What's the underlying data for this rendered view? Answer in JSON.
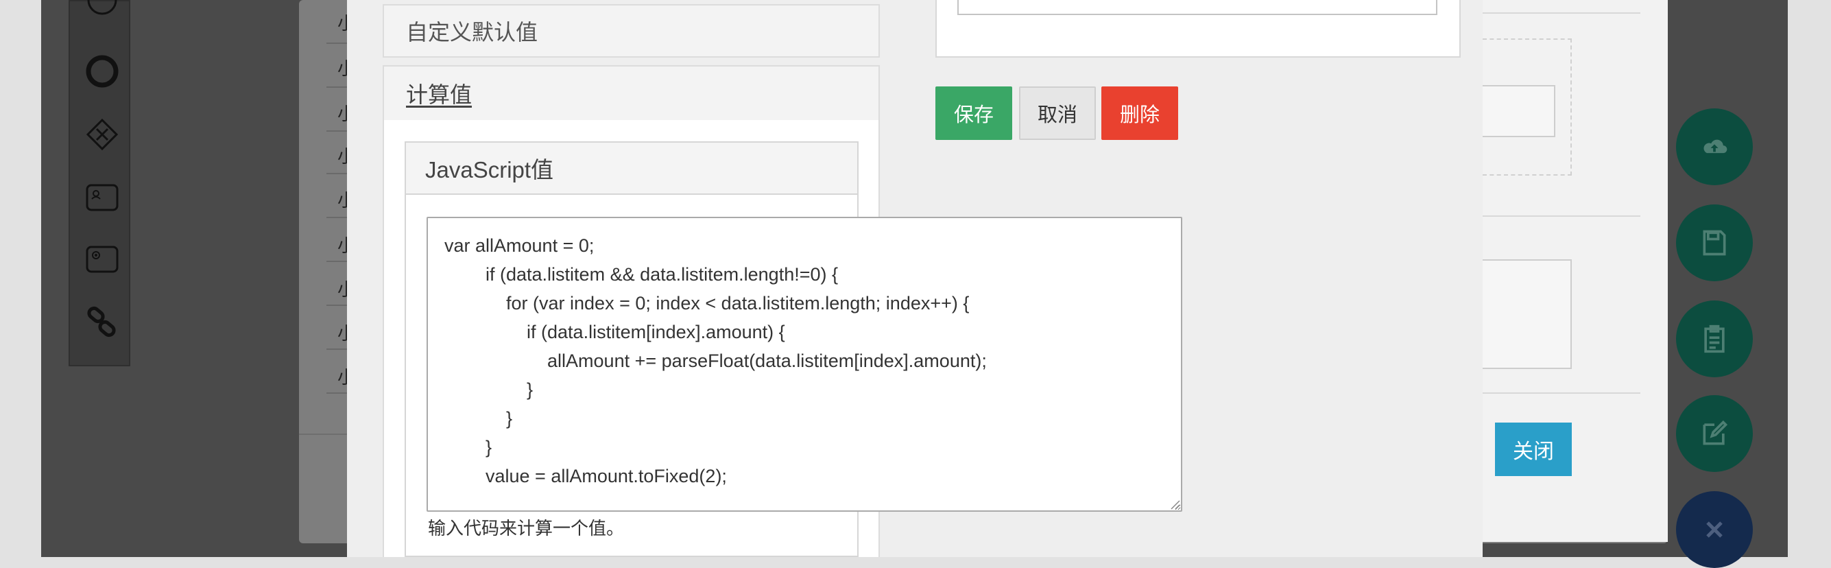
{
  "accordion": {
    "default_value_header": "自定义默认值",
    "calc_value_header": "计算值"
  },
  "js_panel": {
    "title": "JavaScript值",
    "code": "var allAmount = 0;\n        if (data.listitem && data.listitem.length!=0) {\n            for (var index = 0; index < data.listitem.length; index++) {\n                if (data.listitem[index].amount) {\n                    allAmount += parseFloat(data.listitem[index].amount);\n                }\n            }\n        }\n        value = allAmount.toFixed(2);",
    "help": "输入代码来计算一个值。"
  },
  "actions": {
    "save": "保存",
    "cancel": "取消",
    "delete": "删除"
  },
  "right_dialog": {
    "close": "关闭"
  },
  "background": {
    "close": "关闭",
    "row_mark": "小"
  },
  "fabs": [
    "cloud-upload-icon",
    "save-icon",
    "clipboard-icon",
    "edit-icon",
    "close-icon"
  ],
  "colors": {
    "save": "#3aa766",
    "delete": "#e9412f",
    "close": "#2a9fc9",
    "fab": "#0c4d3f"
  }
}
